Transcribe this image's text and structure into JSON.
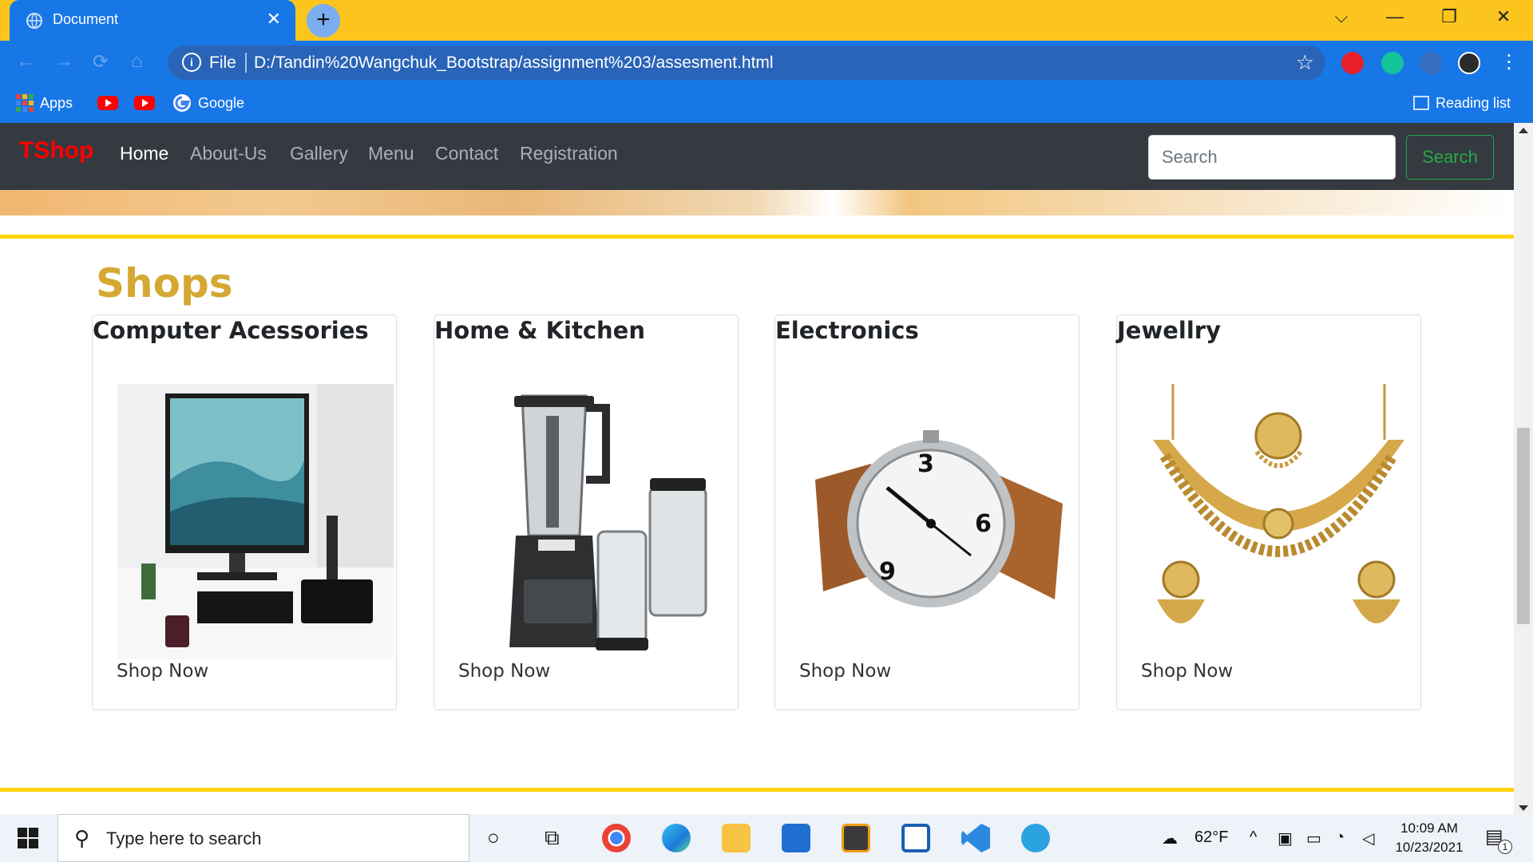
{
  "browser": {
    "tab_title": "Document",
    "tab_close": "✕",
    "new_tab": "+",
    "window_controls": {
      "dropdown": "⌵",
      "minimize": "—",
      "restore": "❐",
      "close": "✕"
    },
    "nav": {
      "back": "←",
      "forward": "→",
      "reload": "⟳",
      "home": "⌂"
    },
    "address": {
      "info": "i",
      "scheme": "File",
      "url": "D:/Tandin%20Wangchuk_Bootstrap/assignment%203/assesment.html",
      "star": "☆"
    },
    "bookmarks": [
      {
        "label": "Apps",
        "icon": "apps-grid-icon"
      },
      {
        "label": "",
        "icon": "youtube-icon"
      },
      {
        "label": "",
        "icon": "youtube-icon"
      },
      {
        "label": "Google",
        "icon": "google-icon"
      }
    ],
    "reading_list": "Reading list"
  },
  "site": {
    "brand": "TShop",
    "nav_links": [
      "Home",
      "About-Us",
      "Gallery",
      "Menu",
      "Contact",
      "Registration"
    ],
    "active_link": "Home",
    "search_placeholder": "Search",
    "search_button": "Search"
  },
  "shops": {
    "title": "Shops",
    "cards": [
      {
        "title": "Computer Acessories",
        "link": "Shop Now",
        "image": "computer-desk-setup"
      },
      {
        "title": "Home & Kitchen",
        "link": "Shop Now",
        "image": "ninja-blender"
      },
      {
        "title": "Electronics",
        "link": "Shop Now",
        "image": "wristwatch"
      },
      {
        "title": "Jewellry",
        "link": "Shop Now",
        "image": "gold-necklace-set"
      }
    ]
  },
  "taskbar": {
    "search_placeholder": "Type here to search",
    "weather": "62°F",
    "time": "10:09 AM",
    "date": "10/23/2021",
    "notifications": "1"
  },
  "colors": {
    "tab_bar": "#fbc51e",
    "chrome_blue": "#1877e6",
    "site_nav": "#343a40",
    "brand_red": "#ff0000",
    "shops_gold": "#d4a833",
    "rule_yellow": "#ffd400",
    "search_green": "#28a745"
  }
}
